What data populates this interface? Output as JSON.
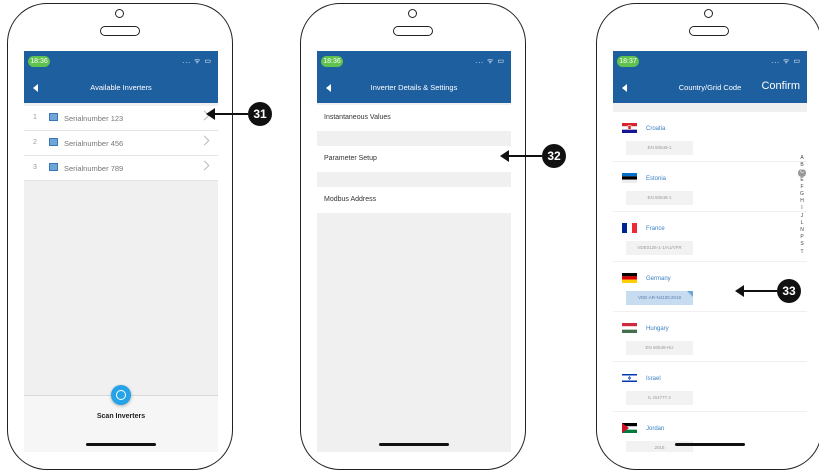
{
  "screen1": {
    "time": "18:36",
    "status_icons": "... ᯤ ▭",
    "title": "Available Inverters",
    "rows": [
      {
        "num": "1",
        "label": "Serialnumber 123"
      },
      {
        "num": "2",
        "label": "Serialnumber 456"
      },
      {
        "num": "3",
        "label": "Serialnumber 789"
      }
    ],
    "scan_label": "Scan Inverters"
  },
  "screen2": {
    "time": "18:36",
    "status_icons": "... ᯤ ▭",
    "title": "Inverter Details & Settings",
    "items": [
      "Instantaneous Values",
      "Parameter Setup",
      "Modbus Address"
    ]
  },
  "screen3": {
    "time": "18:37",
    "status_icons": "... ᯤ ▭",
    "title": "Country/Grid Code",
    "confirm": "Confirm",
    "countries": [
      {
        "name": "Croatia",
        "code": "EN 50549-1"
      },
      {
        "name": "Estonia",
        "code": "EN 50549-1"
      },
      {
        "name": "France",
        "code": "VDE0126-1-1/A1/VFR"
      },
      {
        "name": "Germany",
        "code": "VDE-AR-N4105:2018",
        "selected": true
      },
      {
        "name": "Hungary",
        "code": "EN 50549-HU"
      },
      {
        "name": "Israel",
        "code": "IL IS4777.2"
      },
      {
        "name": "Jordan",
        "code": "2016"
      }
    ],
    "index_letters": [
      "A",
      "B",
      "C",
      "E",
      "F",
      "G",
      "H",
      "I",
      "J",
      "L",
      "N",
      "P",
      "S",
      "T"
    ],
    "index_active": "C"
  },
  "callouts": [
    "31",
    "32",
    "33"
  ],
  "colors": {
    "navbar": "#1e5fa0",
    "accent": "#26a2e8",
    "time_pill": "#5fc14e"
  }
}
